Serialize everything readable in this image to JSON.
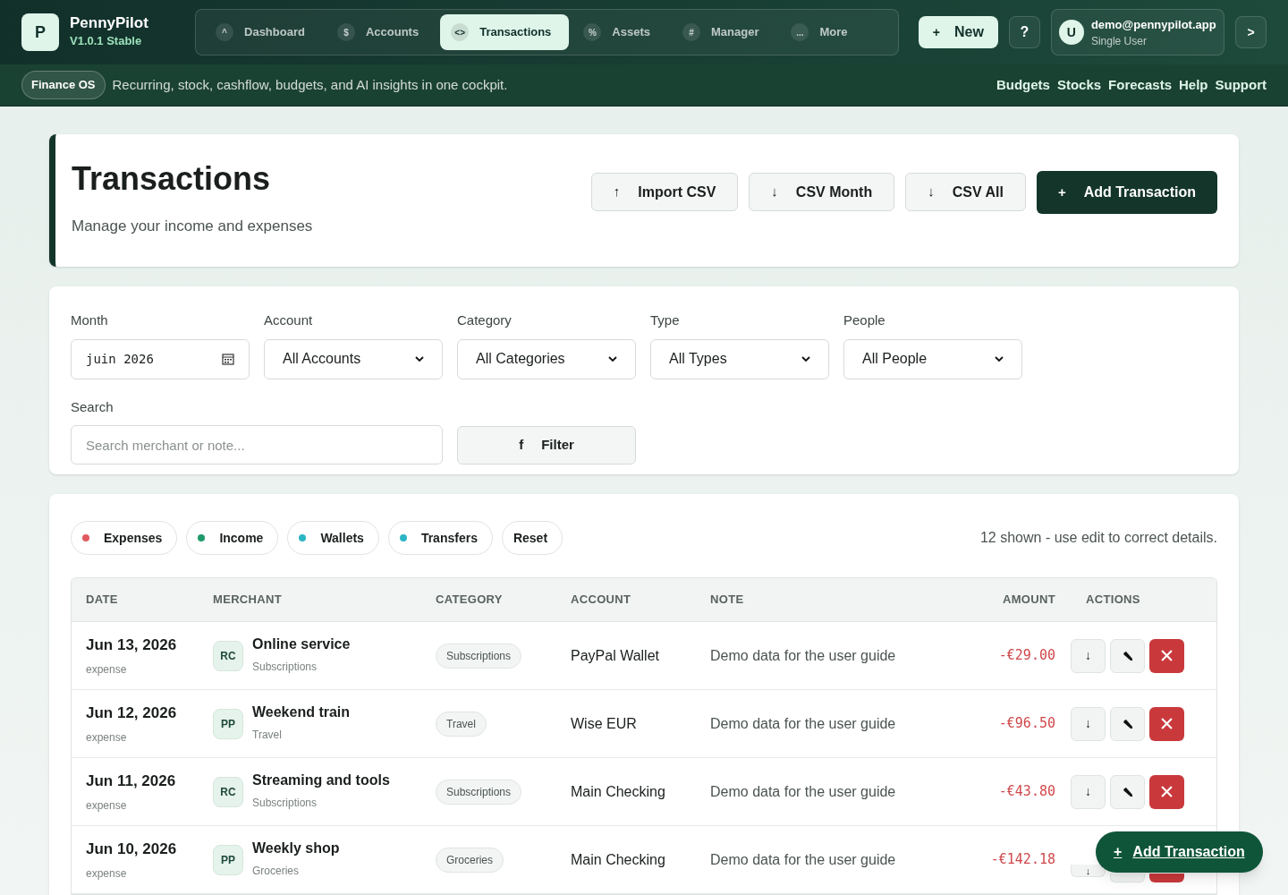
{
  "brand": {
    "logo": "P",
    "name": "PennyPilot",
    "version": "V1.0.1 Stable"
  },
  "nav": [
    {
      "icon": "^",
      "label": "Dashboard",
      "selected": false
    },
    {
      "icon": "$",
      "label": "Accounts",
      "selected": false
    },
    {
      "icon": "<>",
      "label": "Transactions",
      "selected": true
    },
    {
      "icon": "%",
      "label": "Assets",
      "selected": false
    },
    {
      "icon": "#",
      "label": "Manager",
      "selected": false
    },
    {
      "icon": "...",
      "label": "More",
      "selected": false
    }
  ],
  "new_button": {
    "icon": "+",
    "label": "New"
  },
  "help_button": "?",
  "user": {
    "avatar": "U",
    "email": "demo@pennypilot.app",
    "role": "Single User"
  },
  "expand_button": ">",
  "subbar": {
    "badge": "Finance OS",
    "tagline": "Recurring, stock, cashflow, budgets, and AI insights in one cockpit.",
    "links": [
      "Budgets",
      "Stocks",
      "Forecasts",
      "Help",
      "Support"
    ]
  },
  "page": {
    "title": "Transactions",
    "subtitle": "Manage your income and expenses",
    "actions": [
      {
        "icon": "↑",
        "label": "Import CSV",
        "kind": "secondary"
      },
      {
        "icon": "↓",
        "label": "CSV Month",
        "kind": "secondary"
      },
      {
        "icon": "↓",
        "label": "CSV All",
        "kind": "secondary"
      },
      {
        "icon": "+",
        "label": "Add Transaction",
        "kind": "primary"
      }
    ]
  },
  "filters": {
    "month": {
      "label": "Month",
      "value": "juin 2026"
    },
    "selects": [
      {
        "label": "Account",
        "value": "All Accounts"
      },
      {
        "label": "Category",
        "value": "All Categories"
      },
      {
        "label": "Type",
        "value": "All Types"
      },
      {
        "label": "People",
        "value": "All People"
      }
    ],
    "search": {
      "label": "Search",
      "placeholder": "Search merchant or note..."
    },
    "filter_button": {
      "icon": "f",
      "label": "Filter"
    }
  },
  "chips": [
    {
      "label": "Expenses",
      "color": "#e05a5f"
    },
    {
      "label": "Income",
      "color": "#1f9a6a"
    },
    {
      "label": "Wallets",
      "color": "#2bb5c4"
    },
    {
      "label": "Transfers",
      "color": "#2bb5c4"
    },
    {
      "label": "Reset"
    }
  ],
  "summary": "12 shown - use edit to correct details.",
  "table": {
    "columns": [
      "DATE",
      "MERCHANT",
      "CATEGORY",
      "ACCOUNT",
      "NOTE",
      "AMOUNT",
      "ACTIONS"
    ],
    "rows": [
      {
        "date": "Jun 13, 2026",
        "type": "expense",
        "kind": "expense",
        "initials": "RC",
        "merchant": "Online service",
        "subcategory": "Subscriptions",
        "category": "Subscriptions",
        "account": "PayPal Wallet",
        "note": "Demo data for the user guide",
        "amount": "-€29.00",
        "download": "↓"
      },
      {
        "date": "Jun 12, 2026",
        "type": "expense",
        "kind": "expense",
        "initials": "PP",
        "merchant": "Weekend train",
        "subcategory": "Travel",
        "category": "Travel",
        "account": "Wise EUR",
        "note": "Demo data for the user guide",
        "amount": "-€96.50",
        "download": "↓"
      },
      {
        "date": "Jun 11, 2026",
        "type": "expense",
        "kind": "expense",
        "initials": "RC",
        "merchant": "Streaming and tools",
        "subcategory": "Subscriptions",
        "category": "Subscriptions",
        "account": "Main Checking",
        "note": "Demo data for the user guide",
        "amount": "-€43.80",
        "download": "↓"
      },
      {
        "date": "Jun 10, 2026",
        "type": "expense",
        "kind": "expense",
        "initials": "PP",
        "merchant": "Weekly shop",
        "subcategory": "Groceries",
        "category": "Groceries",
        "account": "Main Checking",
        "note": "Demo data for the user guide",
        "amount": "-€142.18",
        "download": "↓"
      }
    ]
  },
  "fab": {
    "icon": "+",
    "label": "Add Transaction"
  }
}
